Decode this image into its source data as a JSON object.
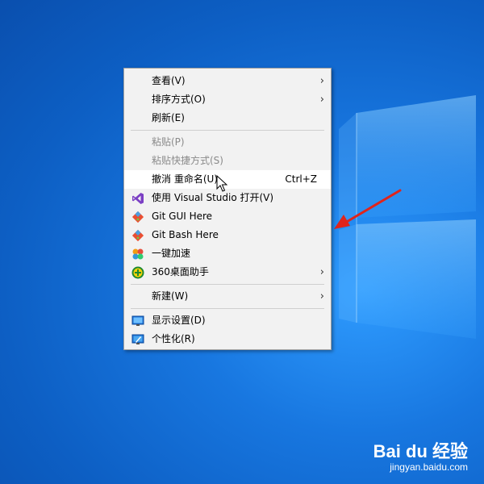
{
  "menu": {
    "items": [
      {
        "label": "查看(V)",
        "submenu": true
      },
      {
        "label": "排序方式(O)",
        "submenu": true
      },
      {
        "label": "刷新(E)"
      },
      {
        "label": "粘贴(P)",
        "disabled": true
      },
      {
        "label": "粘贴快捷方式(S)",
        "disabled": true
      },
      {
        "label": "撤消 重命名(U)",
        "shortcut": "Ctrl+Z"
      },
      {
        "label": "使用 Visual Studio 打开(V)",
        "icon": "visual-studio-icon"
      },
      {
        "label": "Git GUI Here",
        "icon": "git-icon"
      },
      {
        "label": "Git Bash Here",
        "icon": "git-icon"
      },
      {
        "label": "一键加速",
        "icon": "speedup-icon"
      },
      {
        "label": "360桌面助手",
        "icon": "360-icon",
        "submenu": true
      },
      {
        "label": "新建(W)",
        "submenu": true
      },
      {
        "label": "显示设置(D)",
        "icon": "display-icon"
      },
      {
        "label": "个性化(R)",
        "icon": "personalize-icon"
      }
    ],
    "chevron": "›"
  },
  "watermark": {
    "logo_text": "Bai du 经验",
    "url": "jingyan.baidu.com"
  },
  "colors": {
    "desktop": "#1877e0",
    "menu_bg": "#f2f2f2",
    "hover_bg": "#ffffff",
    "disabled_text": "#8a8a8a",
    "arrow": "#e0241b"
  }
}
